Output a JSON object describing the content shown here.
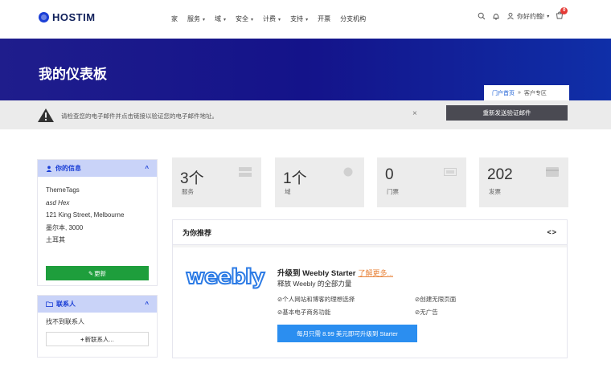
{
  "header": {
    "logo_text": "HOSTIM",
    "menu": [
      {
        "label": "家",
        "caret": false
      },
      {
        "label": "服务",
        "caret": true
      },
      {
        "label": "域",
        "caret": true
      },
      {
        "label": "安全",
        "caret": true
      },
      {
        "label": "计费",
        "caret": true
      },
      {
        "label": "支持",
        "caret": true
      },
      {
        "label": "开票",
        "caret": false
      },
      {
        "label": "分支机构",
        "caret": false
      }
    ],
    "greeting": "你好约翰!",
    "cart_count": "0"
  },
  "hero": {
    "title": "我的仪表板",
    "breadcrumb_home": "门户首页",
    "breadcrumb_sep": "»",
    "breadcrumb_current": "客户专区"
  },
  "alert": {
    "message": "请检查您的电子邮件并点击链接以验证您的电子邮件地址。",
    "close": "×",
    "resend_label": "重新发送验证邮件"
  },
  "info_panel": {
    "title": "你的信息",
    "lines": [
      "ThemeTags",
      "asd Hex",
      "121 King Street, Melbourne",
      "墨尔本, 3000",
      "土耳其"
    ],
    "update_label": "更新"
  },
  "contacts_panel": {
    "title": "联系人",
    "empty_text": "找不到联系人",
    "new_label": "新联系人..."
  },
  "stats": [
    {
      "value": "3个",
      "label": "服务"
    },
    {
      "value": "1个",
      "label": "域"
    },
    {
      "value": "0",
      "label": "门票"
    },
    {
      "value": "202",
      "label": "发票"
    }
  ],
  "recommend": {
    "title": "为你推荐",
    "arrows": "<>",
    "logo": "weebly",
    "heading": "升级到 Weebly Starter",
    "learn_more": "了解更多...",
    "subheading": "释放 Weebly 的全部力量",
    "features": [
      "⊘个人网站和博客的理想选择",
      "⊘创建无限页面",
      "⊘基本电子商务功能",
      "⊘无广告"
    ],
    "button": "每月只需 8.99 美元即可升级到 Starter"
  },
  "colors": {
    "brand": "#1b3fd6",
    "hero": "#1a1a8c",
    "success": "#1e9e3c",
    "button_blue": "#2b8ef0",
    "badge": "#e53935"
  }
}
